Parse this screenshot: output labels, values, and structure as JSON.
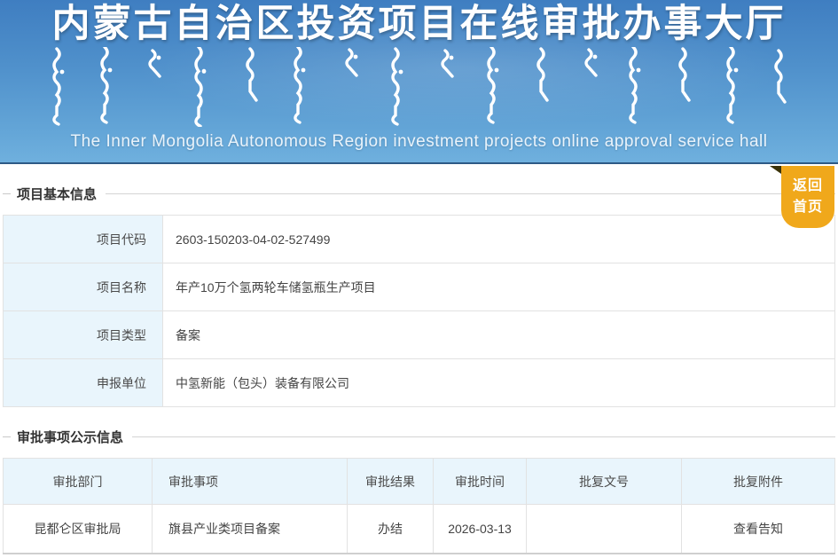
{
  "header": {
    "title_cn": "内蒙古自治区投资项目在线审批办事大厅",
    "subtitle_en": "The Inner Mongolia Autonomous Region investment projects online approval service hall"
  },
  "return_button": {
    "line1": "返回",
    "line2": "首页"
  },
  "sections": {
    "basic_info": {
      "title": "项目基本信息",
      "rows": [
        {
          "label": "项目代码",
          "value": "2603-150203-04-02-527499"
        },
        {
          "label": "项目名称",
          "value": "年产10万个氢两轮车储氢瓶生产项目"
        },
        {
          "label": "项目类型",
          "value": "备案"
        },
        {
          "label": "申报单位",
          "value": "中氢新能（包头）装备有限公司"
        }
      ]
    },
    "approval_info": {
      "title": "审批事项公示信息",
      "columns": [
        "审批部门",
        "审批事项",
        "审批结果",
        "审批时间",
        "批复文号",
        "批复附件"
      ],
      "rows": [
        {
          "department": "昆都仑区审批局",
          "item": "旗县产业类项目备案",
          "result": "办结",
          "time": "2026-03-13",
          "doc_no": "",
          "attachment": "查看告知"
        }
      ]
    }
  },
  "colors": {
    "header_gradient_top": "#3f7ec1",
    "header_gradient_bottom": "#6fb0de",
    "accent_orange": "#f0a81b",
    "table_header_bg": "#e9f5fc"
  }
}
